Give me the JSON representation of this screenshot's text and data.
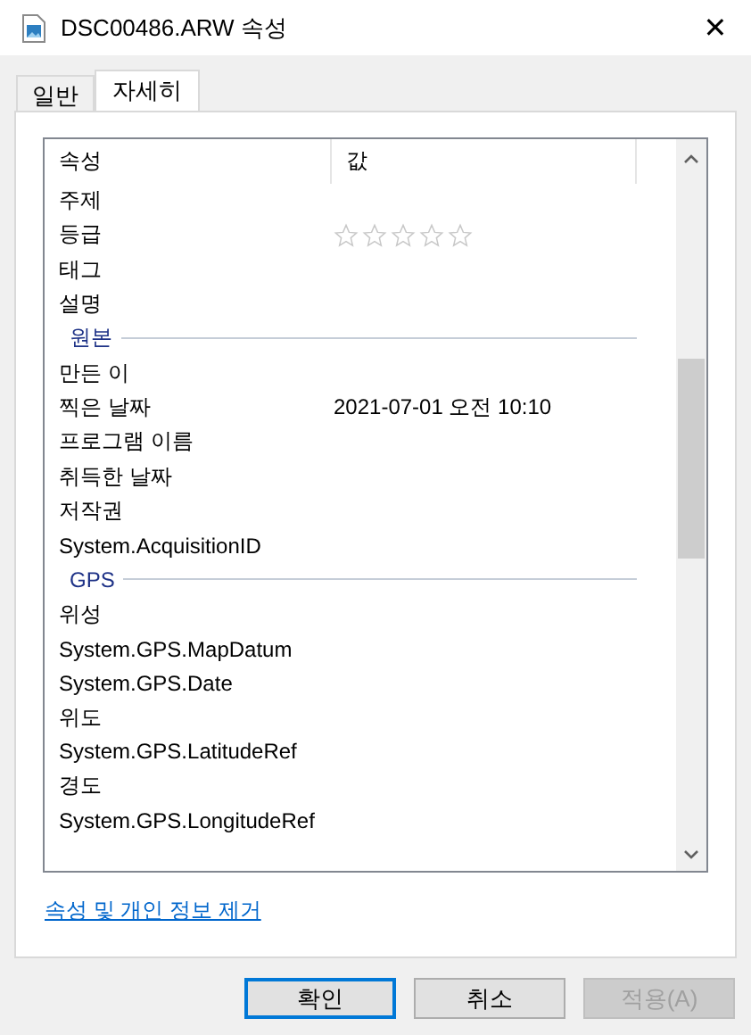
{
  "window": {
    "title": "DSC00486.ARW 속성",
    "close": "✕"
  },
  "tabs": [
    {
      "label": "일반",
      "selected": false
    },
    {
      "label": "자세히",
      "selected": true
    }
  ],
  "details": {
    "columns": [
      "속성",
      "값"
    ],
    "rows": [
      {
        "kind": "property",
        "name": "주제"
      },
      {
        "kind": "rating",
        "name": "등급",
        "stars": 0
      },
      {
        "kind": "property",
        "name": "태그"
      },
      {
        "kind": "property",
        "name": "설명"
      },
      {
        "kind": "group",
        "name": "원본"
      },
      {
        "kind": "property",
        "name": "만든 이"
      },
      {
        "kind": "property",
        "name": "찍은 날짜",
        "value": "2021-07-01 오전 10:10"
      },
      {
        "kind": "property",
        "name": "프로그램 이름"
      },
      {
        "kind": "property",
        "name": "취득한 날짜"
      },
      {
        "kind": "property",
        "name": "저작권"
      },
      {
        "kind": "property",
        "name": "System.AcquisitionID"
      },
      {
        "kind": "group",
        "name": "GPS"
      },
      {
        "kind": "property",
        "name": "위성"
      },
      {
        "kind": "property",
        "name": "System.GPS.MapDatum"
      },
      {
        "kind": "property",
        "name": "System.GPS.Date"
      },
      {
        "kind": "property",
        "name": "위도"
      },
      {
        "kind": "property",
        "name": "System.GPS.LatitudeRef"
      },
      {
        "kind": "property",
        "name": "경도"
      },
      {
        "kind": "property",
        "name": "System.GPS.LongitudeRef"
      }
    ]
  },
  "remove_link": "속성 및 개인 정보 제거",
  "buttons": [
    {
      "label": "확인",
      "default": true,
      "disabled": false
    },
    {
      "label": "취소",
      "default": false,
      "disabled": false
    },
    {
      "label": "적용(A)",
      "default": false,
      "disabled": true
    }
  ]
}
